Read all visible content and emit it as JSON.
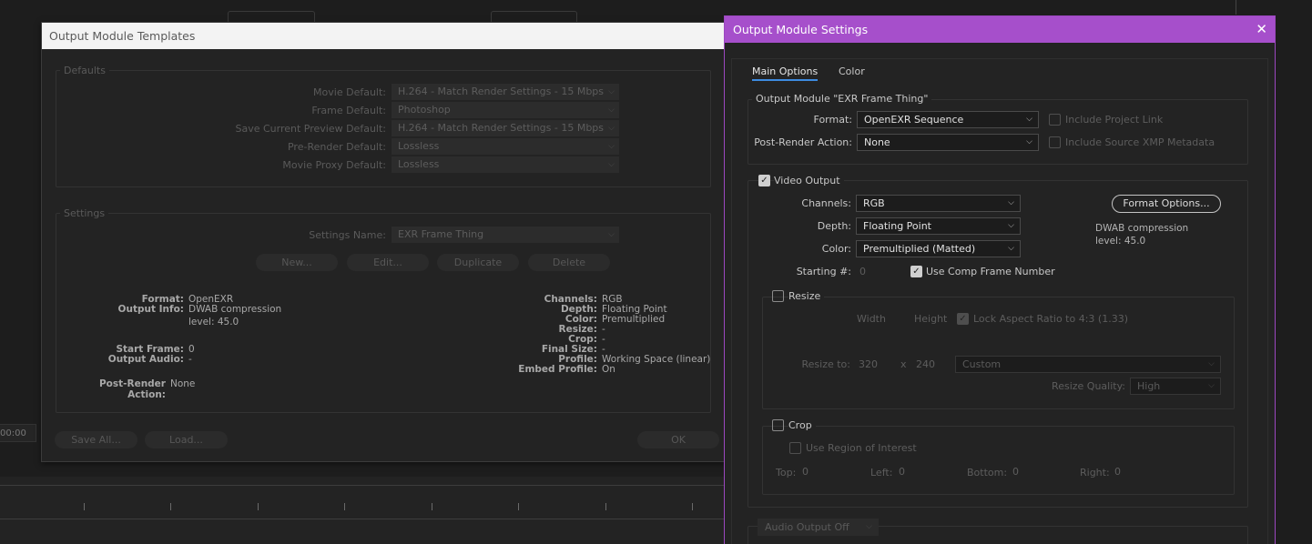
{
  "templates": {
    "title": "Output Module Templates",
    "defaults_label": "Defaults",
    "defaults": [
      {
        "label": "Movie Default:",
        "value": "H.264 - Match Render Settings - 15 Mbps"
      },
      {
        "label": "Frame Default:",
        "value": "Photoshop"
      },
      {
        "label": "Save Current Preview Default:",
        "value": "H.264 - Match Render Settings - 15 Mbps"
      },
      {
        "label": "Pre-Render Default:",
        "value": "Lossless"
      },
      {
        "label": "Movie Proxy Default:",
        "value": "Lossless"
      }
    ],
    "settings_label": "Settings",
    "settings_name_label": "Settings Name:",
    "settings_name_value": "EXR Frame Thing",
    "buttons": {
      "new": "New...",
      "edit": "Edit...",
      "duplicate": "Duplicate",
      "delete": "Delete"
    },
    "info_left": [
      {
        "label": "Format:",
        "value": "OpenEXR"
      },
      {
        "label": "Output Info:",
        "value": "DWAB compression"
      },
      {
        "label": "",
        "value": "level: 45.0"
      },
      {
        "label": "Start Frame:",
        "value": "0"
      },
      {
        "label": "Output Audio:",
        "value": "-"
      }
    ],
    "post_render_label": "Post-Render Action:",
    "post_render_value": "None",
    "info_right": [
      {
        "label": "Channels:",
        "value": "RGB"
      },
      {
        "label": "Depth:",
        "value": "Floating Point"
      },
      {
        "label": "Color:",
        "value": "Premultiplied"
      },
      {
        "label": "Resize:",
        "value": "-"
      },
      {
        "label": "Crop:",
        "value": "-"
      },
      {
        "label": "Final Size:",
        "value": "-"
      },
      {
        "label": "Profile:",
        "value": "Working Space (linear)"
      },
      {
        "label": "Embed Profile:",
        "value": "On"
      }
    ],
    "save_all": "Save All...",
    "load": "Load...",
    "ok": "OK"
  },
  "background": {
    "timecode": "00:00"
  },
  "settings": {
    "title": "Output Module Settings",
    "tabs": [
      "Main Options",
      "Color"
    ],
    "module_group": "Output Module \"EXR Frame Thing\"",
    "format_label": "Format:",
    "format_value": "OpenEXR Sequence",
    "include_project_link": "Include Project Link",
    "post_render_label": "Post-Render Action:",
    "post_render_value": "None",
    "include_xmp": "Include Source XMP Metadata",
    "video_output": "Video Output",
    "channels_label": "Channels:",
    "channels_value": "RGB",
    "depth_label": "Depth:",
    "depth_value": "Floating Point",
    "color_label": "Color:",
    "color_value": "Premultiplied (Matted)",
    "format_options": "Format Options...",
    "compression_info_1": "DWAB compression",
    "compression_info_2": "level: 45.0",
    "starting_label": "Starting #:",
    "starting_value": "0",
    "use_comp_frame": "Use Comp Frame Number",
    "resize": "Resize",
    "width": "Width",
    "height": "Height",
    "lock_aspect": "Lock Aspect Ratio to 4:3 (1.33)",
    "resize_to": "Resize to:",
    "resize_w": "320",
    "x": "x",
    "resize_h": "240",
    "resize_preset": "Custom",
    "resize_quality_label": "Resize Quality:",
    "resize_quality": "High",
    "crop": "Crop",
    "use_roi": "Use Region of Interest",
    "top": "Top:",
    "top_v": "0",
    "left": "Left:",
    "left_v": "0",
    "bottom": "Bottom:",
    "bottom_v": "0",
    "right": "Right:",
    "right_v": "0",
    "audio_output": "Audio Output Off"
  }
}
